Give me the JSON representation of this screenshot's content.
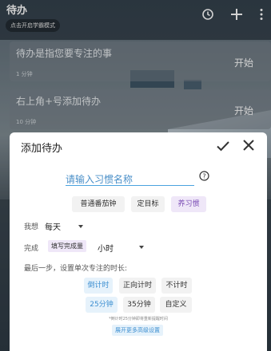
{
  "header": {
    "title": "待办",
    "study_mode_button": "点击开启学霸模式",
    "icons": [
      "clock-icon",
      "add-icon",
      "more-vert-icon"
    ]
  },
  "todo_items": [
    {
      "title": "待办是指您要专注的事",
      "duration": "1 分钟",
      "start": "开始"
    },
    {
      "title": "右上角+号添加待办",
      "duration": "10 分钟",
      "start": "开始"
    }
  ],
  "dialog": {
    "title": "添加待办",
    "name_placeholder": "请输入习惯名称",
    "type_tabs": [
      {
        "label": "普通番茄钟",
        "selected": false
      },
      {
        "label": "定目标",
        "selected": false
      },
      {
        "label": "养习惯",
        "selected": true
      }
    ],
    "wish_label": "我想",
    "frequency_value": "每天",
    "complete_label": "完成",
    "fill_amount_button": "填写完成量",
    "unit_value": "小时",
    "duration_prompt": "最后一步，设置单次专注的时长:",
    "timer_modes": [
      {
        "label": "倒计时",
        "selected": true
      },
      {
        "label": "正向计时",
        "selected": false
      },
      {
        "label": "不计时",
        "selected": false
      }
    ],
    "durations": [
      {
        "label": "25分钟",
        "selected": true
      },
      {
        "label": "35分钟",
        "selected": false
      },
      {
        "label": "自定义",
        "selected": false
      }
    ],
    "note": "*倒计时25分钟即将重新提醒时间",
    "advanced_button": "展开更多高级设置"
  },
  "colors": {
    "accent_blue": "#3d8fd1",
    "accent_purple": "#7a4bb4"
  }
}
